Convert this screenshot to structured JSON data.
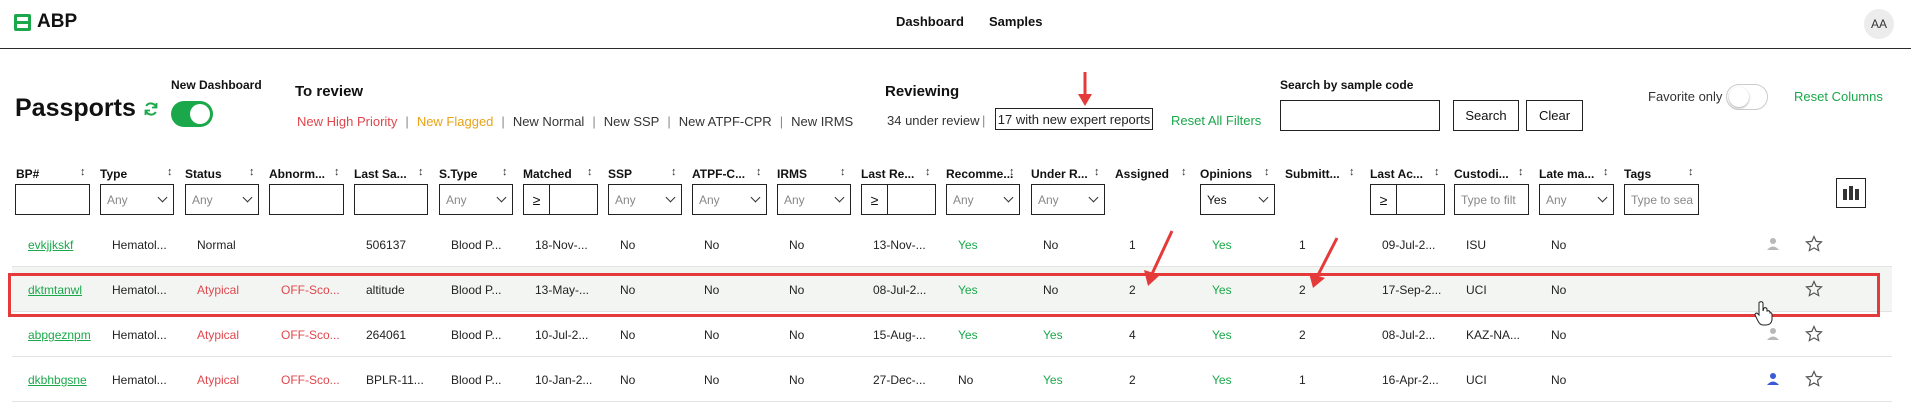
{
  "app": {
    "logo_text": "ABP",
    "logo_icon": "abp-logo-icon",
    "avatar_initials": "AA"
  },
  "nav": {
    "dashboard": "Dashboard",
    "samples": "Samples"
  },
  "header": {
    "title": "Passports",
    "new_dashboard_label": "New Dashboard",
    "to_review_label": "To review",
    "reviewing_label": "Reviewing",
    "under_review": "34 under review",
    "separator": "|",
    "expert_reports": "17 with new expert reports",
    "reset_all_filters": "Reset All Filters",
    "search_label": "Search by sample code",
    "search_button": "Search",
    "clear_button": "Clear",
    "favorite_only": "Favorite only",
    "reset_columns": "Reset Columns"
  },
  "review_links": [
    {
      "label": "New High Priority",
      "color": "#e0474c"
    },
    {
      "label": "New Flagged",
      "color": "#e8a317"
    },
    {
      "label": "New Normal",
      "color": "#333333"
    },
    {
      "label": "New SSP",
      "color": "#333333"
    },
    {
      "label": "New ATPF-CPR",
      "color": "#333333"
    },
    {
      "label": "New IRMS",
      "color": "#333333"
    }
  ],
  "columns": {
    "bp": "BP#",
    "type": "Type",
    "status": "Status",
    "abnormal": "Abnorm...",
    "last_sample": "Last Sa...",
    "stype": "S.Type",
    "matched": "Matched",
    "ssp": "SSP",
    "atpf": "ATPF-C...",
    "irms": "IRMS",
    "last_review": "Last Re...",
    "recommend": "Recomme...",
    "under_review": "Under R...",
    "assigned": "Assigned",
    "opinions": "Opinions",
    "submitted": "Submitt...",
    "last_action": "Last Ac...",
    "custodian": "Custodi...",
    "late": "Late ma...",
    "tags": "Tags",
    "sort_icon": "↕"
  },
  "filters": {
    "any": "Any",
    "ge": "≥",
    "opinions_value": "Yes",
    "custodian_placeholder": "Type to filt",
    "tags_placeholder": "Type to sea"
  },
  "rows": [
    {
      "bp": "evkjjkskf",
      "type": "Hematol...",
      "status": "Normal",
      "abnormal": "",
      "last_sample": "506137",
      "stype": "Blood P...",
      "matched": "18-Nov-...",
      "ssp": "No",
      "atpf": "No",
      "irms": "No",
      "last_review": "13-Nov-...",
      "recommend": "Yes",
      "under_review": "No",
      "assigned": "1",
      "opinions": "Yes",
      "submitted": "1",
      "last_action": "09-Jul-2...",
      "custodian": "ISU",
      "late": "No",
      "person_color": "#b8b8b8"
    },
    {
      "bp": "dktmtanwl",
      "type": "Hematol...",
      "status": "Atypical",
      "abnormal": "OFF-Sco...",
      "last_sample": "altitude",
      "stype": "Blood P...",
      "matched": "13-May-...",
      "ssp": "No",
      "atpf": "No",
      "irms": "No",
      "last_review": "08-Jul-2...",
      "recommend": "Yes",
      "under_review": "No",
      "assigned": "2",
      "opinions": "Yes",
      "submitted": "2",
      "last_action": "17-Sep-2...",
      "custodian": "UCI",
      "late": "No",
      "person_color": ""
    },
    {
      "bp": "abpgeznpm",
      "type": "Hematol...",
      "status": "Atypical",
      "abnormal": "OFF-Sco...",
      "last_sample": "264061",
      "stype": "Blood P...",
      "matched": "10-Jul-2...",
      "ssp": "No",
      "atpf": "No",
      "irms": "No",
      "last_review": "15-Aug-...",
      "recommend": "Yes",
      "under_review": "Yes",
      "assigned": "4",
      "opinions": "Yes",
      "submitted": "2",
      "last_action": "08-Jul-2...",
      "custodian": "KAZ-NA...",
      "late": "No",
      "person_color": "#b8b8b8"
    },
    {
      "bp": "dkbhbgsne",
      "type": "Hematol...",
      "status": "Atypical",
      "abnormal": "OFF-Sco...",
      "last_sample": "BPLR-11...",
      "stype": "Blood P...",
      "matched": "10-Jan-2...",
      "ssp": "No",
      "atpf": "No",
      "irms": "No",
      "last_review": "27-Dec-...",
      "recommend": "No",
      "under_review": "Yes",
      "assigned": "2",
      "opinions": "Yes",
      "submitted": "1",
      "last_action": "16-Apr-2...",
      "custodian": "UCI",
      "late": "No",
      "person_color": "#3b5bd6"
    }
  ],
  "colors": {
    "accent_green": "#1aa84a",
    "alert_red": "#e0474c",
    "flag_orange": "#e8a317",
    "annotation_red": "#e53a3a"
  }
}
